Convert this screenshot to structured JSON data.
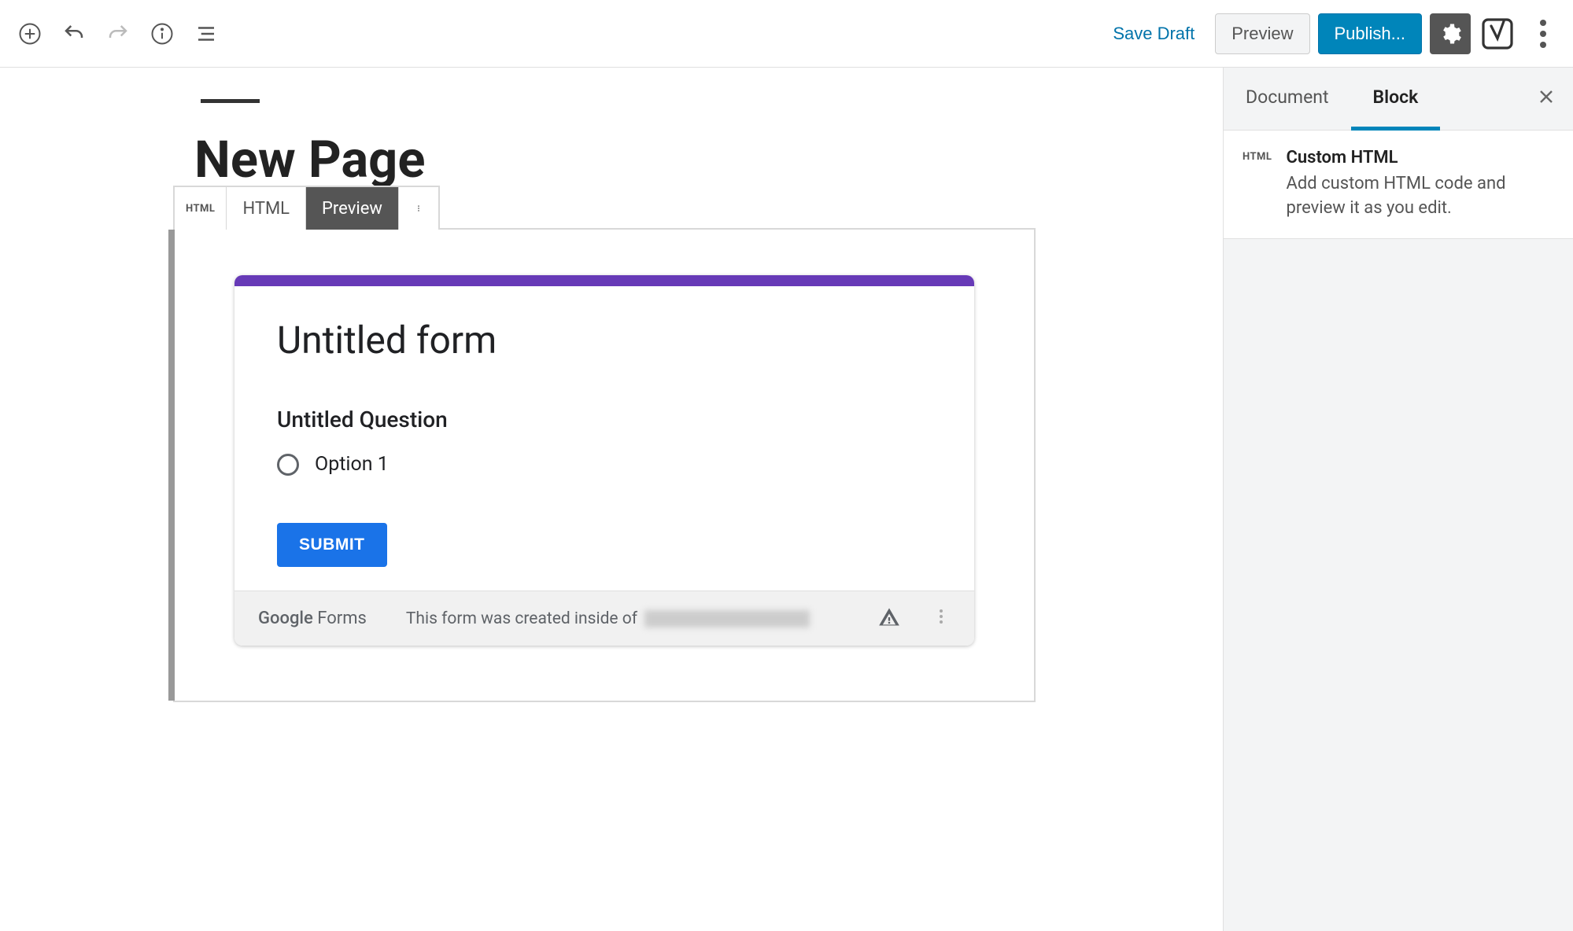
{
  "toolbar": {
    "save_draft": "Save Draft",
    "preview": "Preview",
    "publish": "Publish..."
  },
  "sidebar": {
    "tabs": {
      "document": "Document",
      "block": "Block"
    },
    "block_info": {
      "icon_label": "HTML",
      "title": "Custom HTML",
      "desc": "Add custom HTML code and preview it as you edit."
    }
  },
  "editor": {
    "page_title": "New Page",
    "block_toolbar": {
      "icon_label": "HTML",
      "html": "HTML",
      "preview": "Preview"
    },
    "gform": {
      "title": "Untitled form",
      "question": "Untitled Question",
      "option1": "Option 1",
      "submit": "SUBMIT",
      "brand_google": "Google",
      "brand_forms": " Forms",
      "origin_prefix": "This form was created inside of "
    }
  }
}
